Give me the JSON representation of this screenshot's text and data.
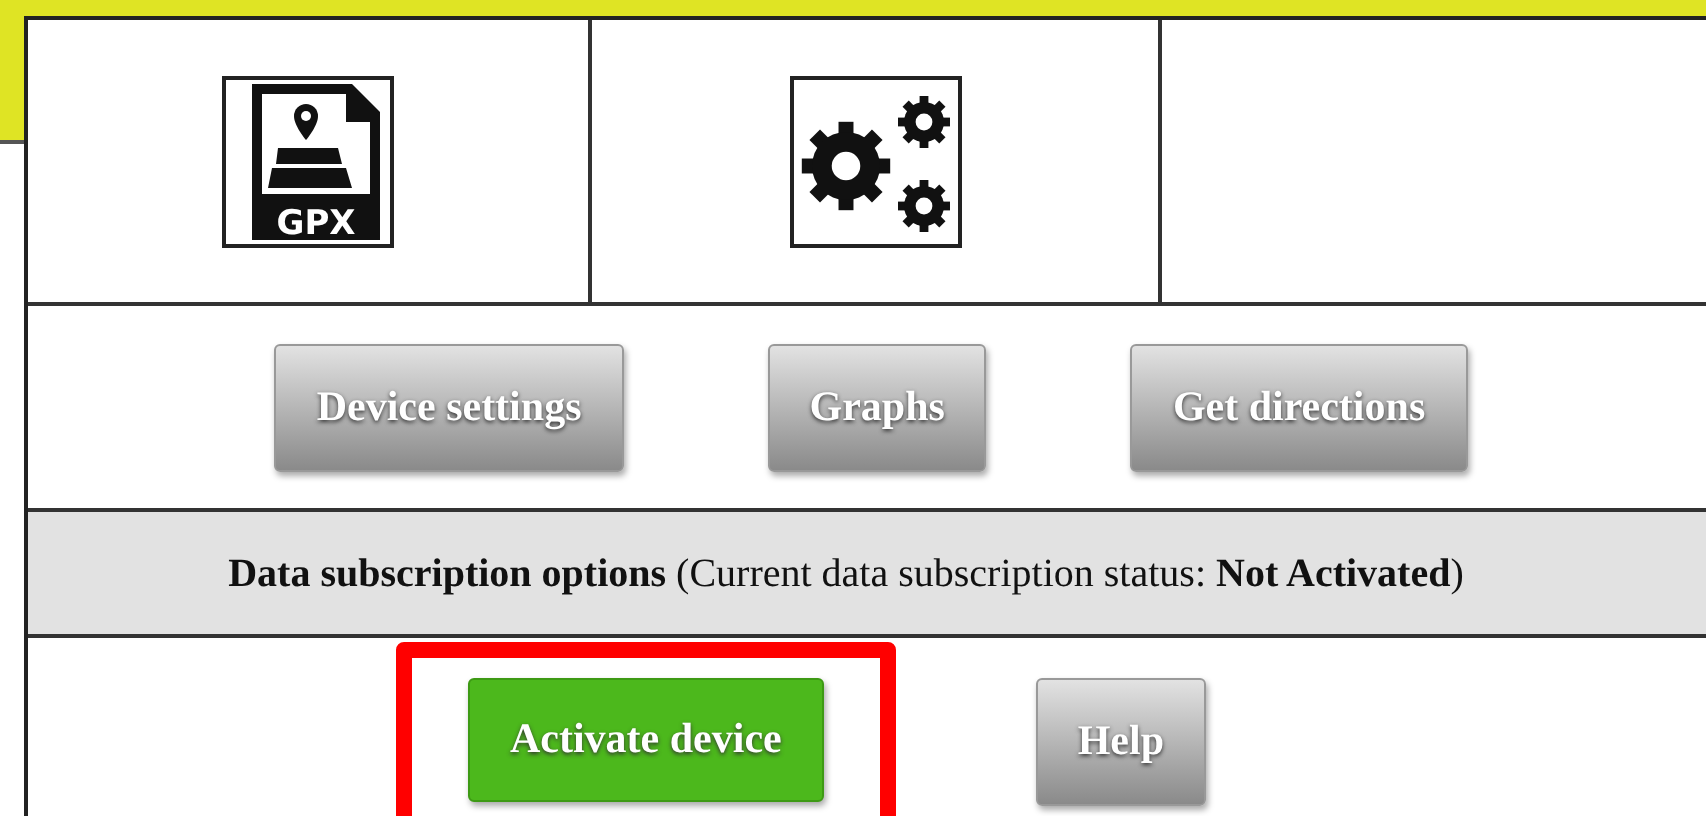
{
  "icons": [
    {
      "kind": "gpx-file",
      "label": "GPX"
    },
    {
      "kind": "gears"
    },
    {
      "kind": "empty"
    }
  ],
  "tool_buttons": [
    {
      "label": "Device settings"
    },
    {
      "label": "Graphs"
    },
    {
      "label": "Get directions"
    }
  ],
  "subscription": {
    "text": "**Data subscription options** (Current data subscription status: **Not Activated**)"
  },
  "action_buttons": [
    {
      "label": "Activate device",
      "kind": "primary",
      "highlighted": true
    },
    {
      "label": "Help",
      "kind": "default",
      "highlighted": false
    }
  ]
}
